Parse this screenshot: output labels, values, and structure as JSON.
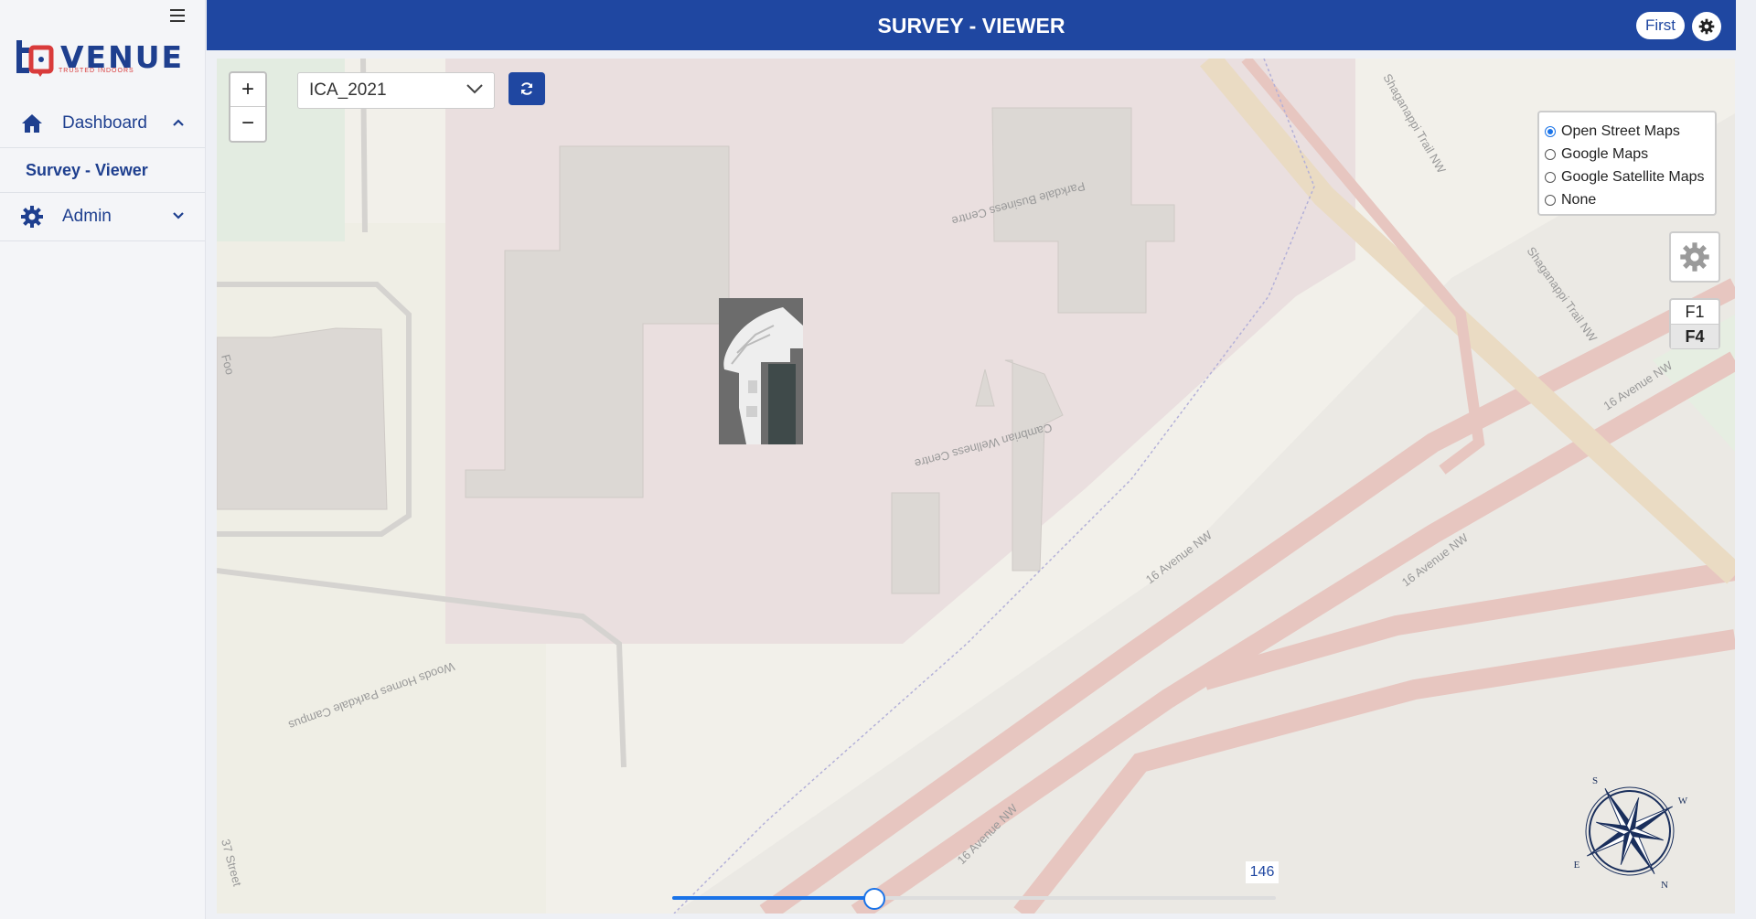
{
  "app": {
    "logo_text": "VENUE",
    "logo_tagline": "TRUSTED INDOORS",
    "brand_color": "#1f47a1"
  },
  "sidebar": {
    "items": [
      {
        "label": "Dashboard",
        "icon": "home-icon",
        "expanded": true
      },
      {
        "label": "Survey - Viewer",
        "active": true
      },
      {
        "label": "Admin",
        "icon": "gear-icon",
        "expanded": false
      }
    ]
  },
  "header": {
    "title": "SURVEY - VIEWER",
    "user_label": "First"
  },
  "map": {
    "project_select": {
      "value": "ICA_2021"
    },
    "base_layers": [
      {
        "label": "Open Street Maps",
        "selected": true
      },
      {
        "label": "Google Maps",
        "selected": false
      },
      {
        "label": "Google Satellite Maps",
        "selected": false
      },
      {
        "label": "None",
        "selected": false
      }
    ],
    "floors": [
      "F1",
      "F4"
    ],
    "active_floor": "F4",
    "zoom_in_label": "+",
    "zoom_out_label": "−",
    "slider": {
      "value": 146,
      "fraction": 0.335,
      "display": "146"
    },
    "labels": {
      "business_centre": "Parkdale Business Centre",
      "wellness_centre": "Cambrian Wellness Centre",
      "homes_campus": "Woods Homes Parkdale Campus",
      "road_16ave_1": "16 Avenue NW",
      "road_16ave_2": "16 Avenue NW",
      "road_16ave_3": "16 Avenue NW",
      "road_16ave_4": "16 Avenue NW",
      "shaganappi_1": "Shaganappi Trail NW",
      "shaganappi_2": "Shaganappi Trail NW",
      "street_37": "37 Street",
      "food": "Foo"
    },
    "compass_letters": {
      "s": "S",
      "w": "W",
      "n": "N",
      "e": "E"
    }
  }
}
